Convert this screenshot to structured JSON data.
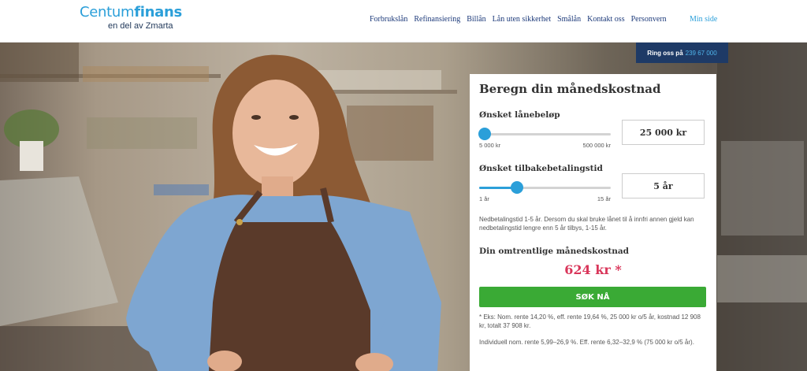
{
  "header": {
    "logo": {
      "main": "Centum",
      "bold": "finans",
      "sub": "en del av Zmarta"
    },
    "nav": [
      "Forbrukslån",
      "Refinansiering",
      "Billån",
      "Lån uten sikkerhet",
      "Smålån",
      "Kontakt oss",
      "Personvern"
    ],
    "min_side": "Min side"
  },
  "ring": {
    "label": "Ring oss på",
    "number": "239 67 000"
  },
  "calculator": {
    "title": "Beregn din månedskostnad",
    "amount": {
      "label": "Ønsket lånebeløp",
      "min": "5 000 kr",
      "max": "500 000 kr",
      "value": "25 000 kr",
      "level": 0.04
    },
    "term": {
      "label": "Ønsket tilbakebetalingstid",
      "min": "1 år",
      "max": "15 år",
      "value": "5 år",
      "level": 0.29
    },
    "term_note": "Nedbetalingstid 1-5 år. Dersom du skal bruke lånet til å innfri annen gjeld kan nedbetalingstid lengre enn 5 år tilbys, 1-15 år.",
    "cost_label": "Din omtrentlige månedskostnad",
    "cost_value": "624 kr *",
    "cta": "SØK NÅ",
    "example": "* Eks: Nom. rente 14,20 %, eff. rente 19,64 %, 25 000 kr o/5 år, kostnad 12 908 kr, totalt 37 908 kr.",
    "interest_note": "Individuell nom. rente 5,99–26,9 %. Eff. rente 6,32–32,9 % (75 000 kr o/5 år).",
    "colors": {
      "accent": "#2b9fd9",
      "cta": "#3aaa35",
      "cost": "#d9365a"
    }
  }
}
